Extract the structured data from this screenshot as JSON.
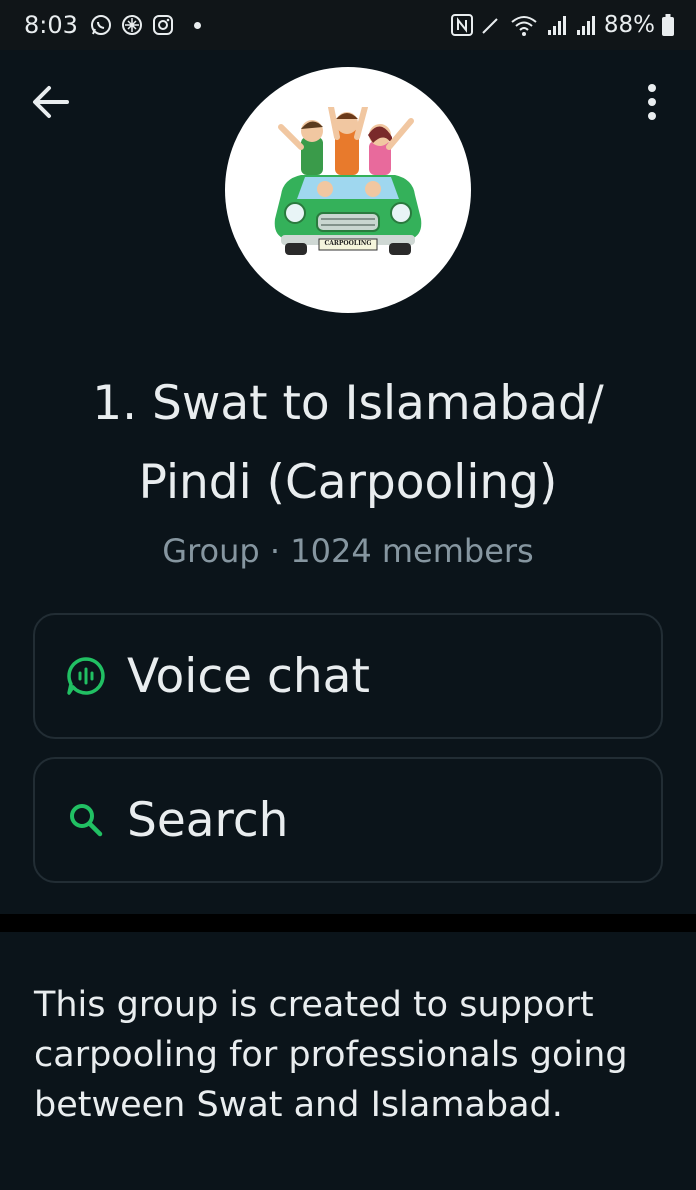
{
  "status_bar": {
    "time": "8:03",
    "left_icons": [
      "whatsapp-icon",
      "chatgpt-icon",
      "instagram-icon"
    ],
    "right_icons": [
      "nfc-icon",
      "pen-icon",
      "wifi-icon",
      "signal-icon",
      "signal-icon"
    ],
    "battery": "88%"
  },
  "header": {
    "back_icon": "arrow-left-icon",
    "menu_icon": "more-vertical-icon"
  },
  "avatar": {
    "caption": "CARPOOLING"
  },
  "group": {
    "title_line1": "1. Swat to Islamabad/",
    "title_line2": "Pindi (Carpooling)",
    "meta": "Group · 1024 members"
  },
  "actions": {
    "voice_chat_label": "Voice chat",
    "search_label": "Search"
  },
  "description": "This group is created to support carpooling for professionals going between Swat and Islamabad.",
  "colors": {
    "background": "#0b141a",
    "accent_green": "#21c063",
    "text_primary": "#e9edef",
    "text_secondary": "#8696a0",
    "card_border": "#222d34"
  }
}
